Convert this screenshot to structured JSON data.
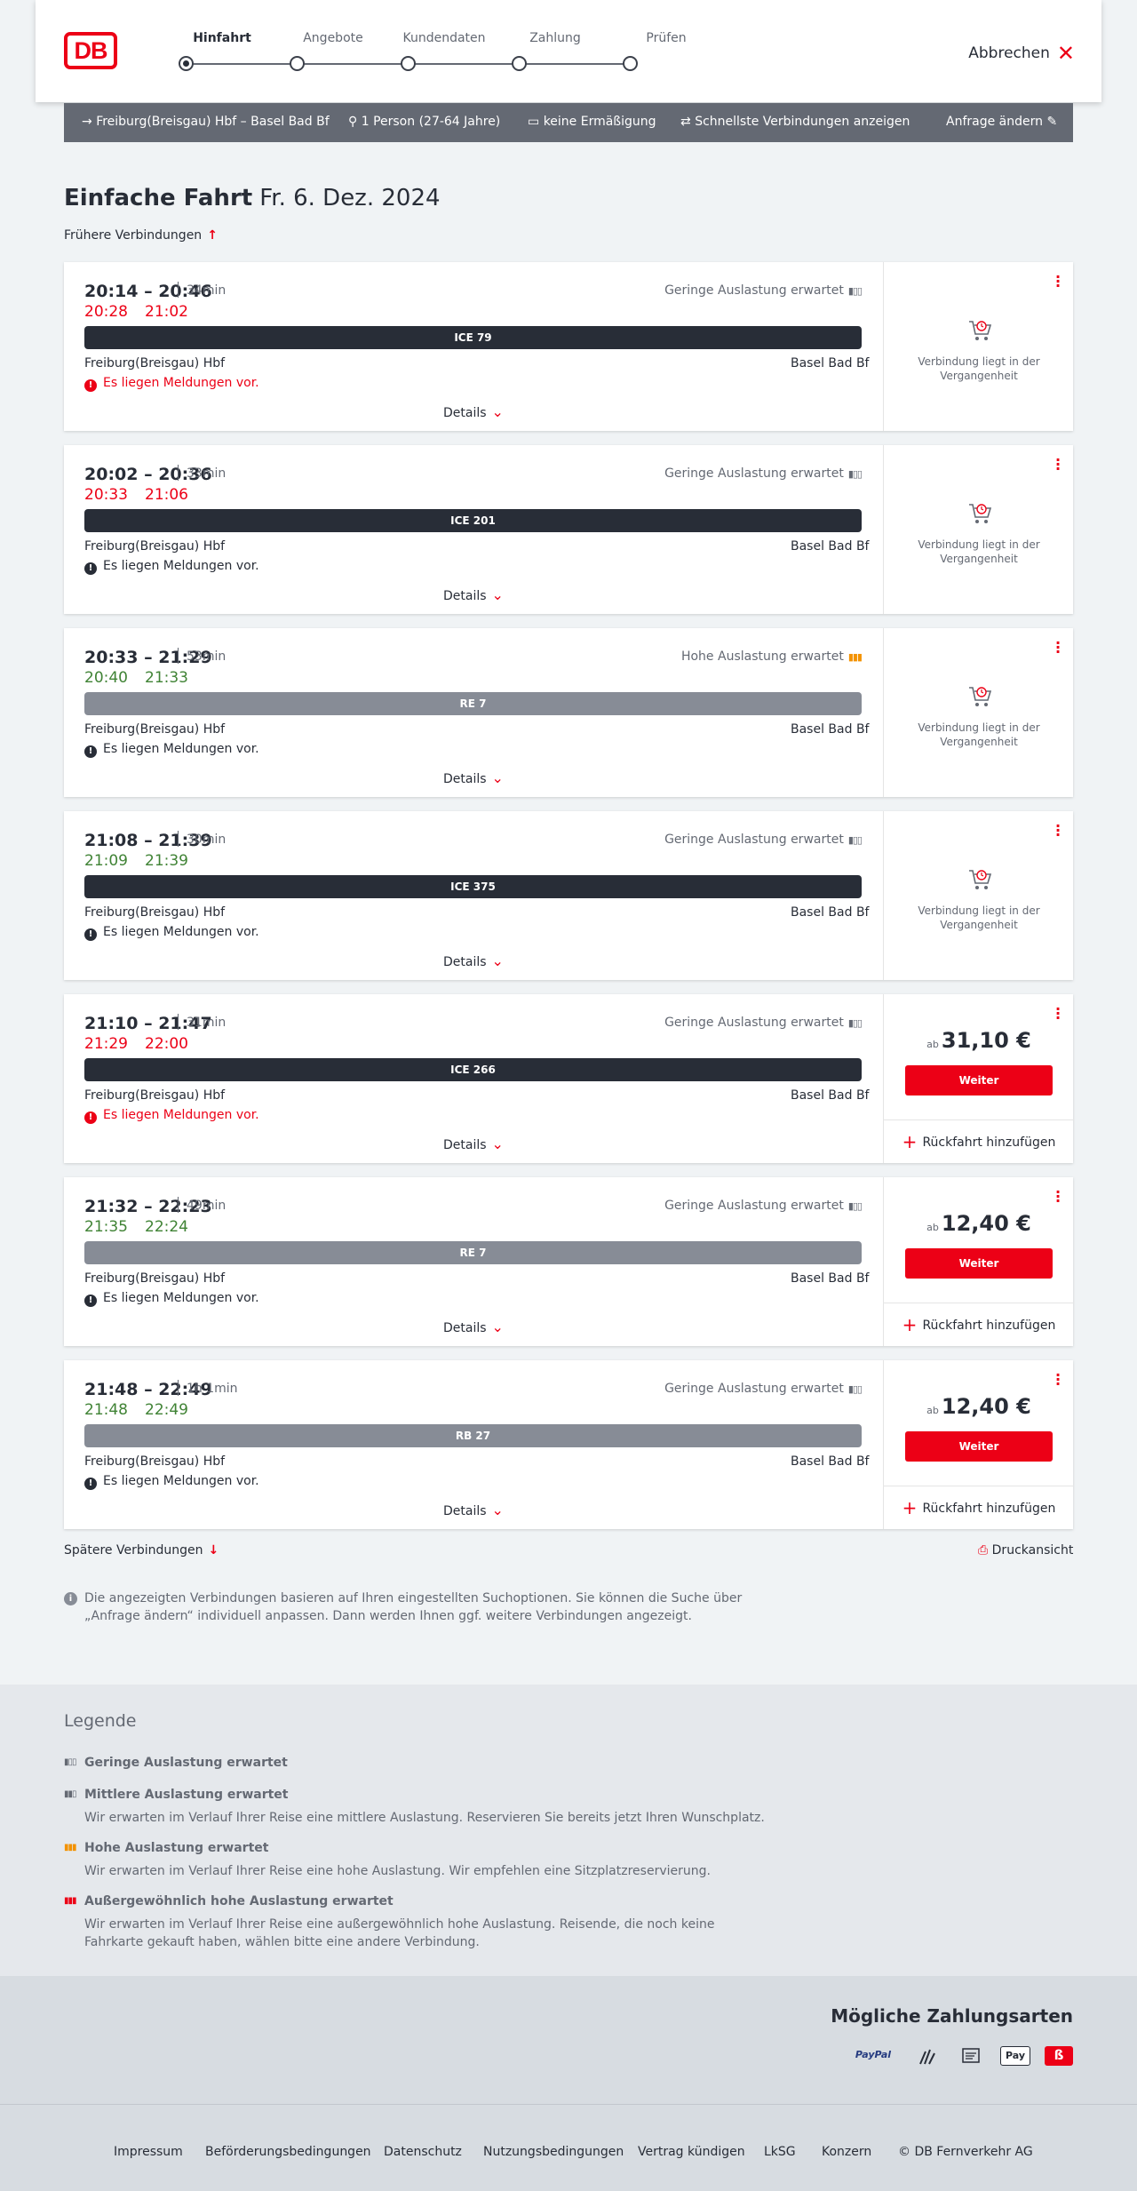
{
  "header": {
    "logo": "DB",
    "cancel_label": "Abbrechen",
    "steps": [
      "Hinfahrt",
      "Angebote",
      "Kundendaten",
      "Zahlung",
      "Prüfen"
    ]
  },
  "infobar": {
    "route": "Freiburg(Breisgau) Hbf – Basel Bad Bf",
    "persons": "1 Person (27-64 Jahre)",
    "discount": "keine Ermäßigung",
    "option": "Schnellste Verbindungen anzeigen",
    "change": "Anfrage ändern"
  },
  "title": {
    "main": "Einfache Fahrt",
    "date": "Fr. 6. Dez. 2024"
  },
  "earlier": "Frühere Verbindungen",
  "later": "Spätere Verbindungen",
  "print": "Druckansicht",
  "connections": [
    {
      "times": "20:14 – 20:46",
      "duration": "34min",
      "rt_dep": "20:28",
      "rt_arr": "21:02",
      "rt_color": "red",
      "load": "Geringe Auslastung erwartet",
      "load_level": "low",
      "train": "ICE 79",
      "train_style": "dark",
      "from": "Freiburg(Breisgau) Hbf",
      "to": "Basel Bad Bf",
      "message": "Es liegen Meldungen vor.",
      "message_style": "red",
      "details": "Details",
      "past": "Verbindung liegt in der Vergangenheit"
    },
    {
      "times": "20:02 – 20:36",
      "duration": "33min",
      "rt_dep": "20:33",
      "rt_arr": "21:06",
      "rt_color": "red",
      "load": "Geringe Auslastung erwartet",
      "load_level": "low",
      "train": "ICE 201",
      "train_style": "dark",
      "from": "Freiburg(Breisgau) Hbf",
      "to": "Basel Bad Bf",
      "message": "Es liegen Meldungen vor.",
      "message_style": "normal",
      "details": "Details",
      "past": "Verbindung liegt in der Vergangenheit"
    },
    {
      "times": "20:33 – 21:29",
      "duration": "53min",
      "rt_dep": "20:40",
      "rt_arr": "21:33",
      "rt_color": "green",
      "load": "Hohe Auslastung erwartet",
      "load_level": "high",
      "train": "RE 7",
      "train_style": "grey",
      "from": "Freiburg(Breisgau) Hbf",
      "to": "Basel Bad Bf",
      "message": "Es liegen Meldungen vor.",
      "message_style": "normal",
      "details": "Details",
      "past": "Verbindung liegt in der Vergangenheit"
    },
    {
      "times": "21:08 – 21:39",
      "duration": "30min",
      "rt_dep": "21:09",
      "rt_arr": "21:39",
      "rt_color": "green",
      "load": "Geringe Auslastung erwartet",
      "load_level": "low",
      "train": "ICE 375",
      "train_style": "dark",
      "from": "Freiburg(Breisgau) Hbf",
      "to": "Basel Bad Bf",
      "message": "Es liegen Meldungen vor.",
      "message_style": "normal",
      "details": "Details",
      "past": "Verbindung liegt in der Vergangenheit"
    },
    {
      "times": "21:10 – 21:47",
      "duration": "31min",
      "rt_dep": "21:29",
      "rt_arr": "22:00",
      "rt_color": "red",
      "load": "Geringe Auslastung erwartet",
      "load_level": "low",
      "train": "ICE 266",
      "train_style": "dark",
      "from": "Freiburg(Breisgau) Hbf",
      "to": "Basel Bad Bf",
      "message": "Es liegen Meldungen vor.",
      "message_style": "red",
      "details": "Details",
      "price_prefix": "ab",
      "price": "31,10 €",
      "button": "Weiter",
      "add_return": "Rückfahrt hinzufügen"
    },
    {
      "times": "21:32 – 22:23",
      "duration": "49min",
      "rt_dep": "21:35",
      "rt_arr": "22:24",
      "rt_color": "green",
      "load": "Geringe Auslastung erwartet",
      "load_level": "low",
      "train": "RE 7",
      "train_style": "grey",
      "from": "Freiburg(Breisgau) Hbf",
      "to": "Basel Bad Bf",
      "message": "Es liegen Meldungen vor.",
      "message_style": "normal",
      "details": "Details",
      "price_prefix": "ab",
      "price": "12,40 €",
      "button": "Weiter",
      "add_return": "Rückfahrt hinzufügen"
    },
    {
      "times": "21:48 – 22:49",
      "duration": "1h 1min",
      "rt_dep": "21:48",
      "rt_arr": "22:49",
      "rt_color": "green",
      "load": "Geringe Auslastung erwartet",
      "load_level": "low",
      "train": "RB 27",
      "train_style": "grey",
      "from": "Freiburg(Breisgau) Hbf",
      "to": "Basel Bad Bf",
      "message": "Es liegen Meldungen vor.",
      "message_style": "normal",
      "details": "Details",
      "price_prefix": "ab",
      "price": "12,40 €",
      "button": "Weiter",
      "add_return": "Rückfahrt hinzufügen"
    }
  ],
  "note": "Die angezeigten Verbindungen basieren auf Ihren eingestellten Suchoptionen. Sie können die Suche über „Anfrage ändern“ individuell anpassen. Dann werden Ihnen ggf. weitere Verbindungen angezeigt.",
  "legend": {
    "title": "Legende",
    "items": [
      {
        "title": "Geringe Auslastung erwartet",
        "desc": ""
      },
      {
        "title": "Mittlere Auslastung erwartet",
        "desc": "Wir erwarten im Verlauf Ihrer Reise eine mittlere Auslastung. Reservieren Sie bereits jetzt Ihren Wunschplatz."
      },
      {
        "title": "Hohe Auslastung erwartet",
        "desc": "Wir erwarten im Verlauf Ihrer Reise eine hohe Auslastung. Wir empfehlen eine Sitzplatzreservierung."
      },
      {
        "title": "Außergewöhnlich hohe Auslastung erwartet",
        "desc": "Wir erwarten im Verlauf Ihrer Reise eine außergewöhnlich hohe Auslastung. Reisende, die noch keine Fahrkarte gekauft haben, wählen bitte eine andere Verbindung."
      }
    ]
  },
  "payment": {
    "title": "Mögliche Zahlungsarten",
    "methods": [
      "PayPal",
      "Pay"
    ]
  },
  "footer": [
    "Impressum",
    "Beförderungsbedingungen",
    "Datenschutz",
    "Nutzungsbedingungen",
    "Vertrag kündigen",
    "LkSG",
    "Konzern",
    "© DB Fernverkehr AG"
  ],
  "colors": {
    "brand_red": "#ec0016",
    "delay_red": "#ec0016",
    "on_time_green": "#408335",
    "high_load": "#f39200"
  }
}
